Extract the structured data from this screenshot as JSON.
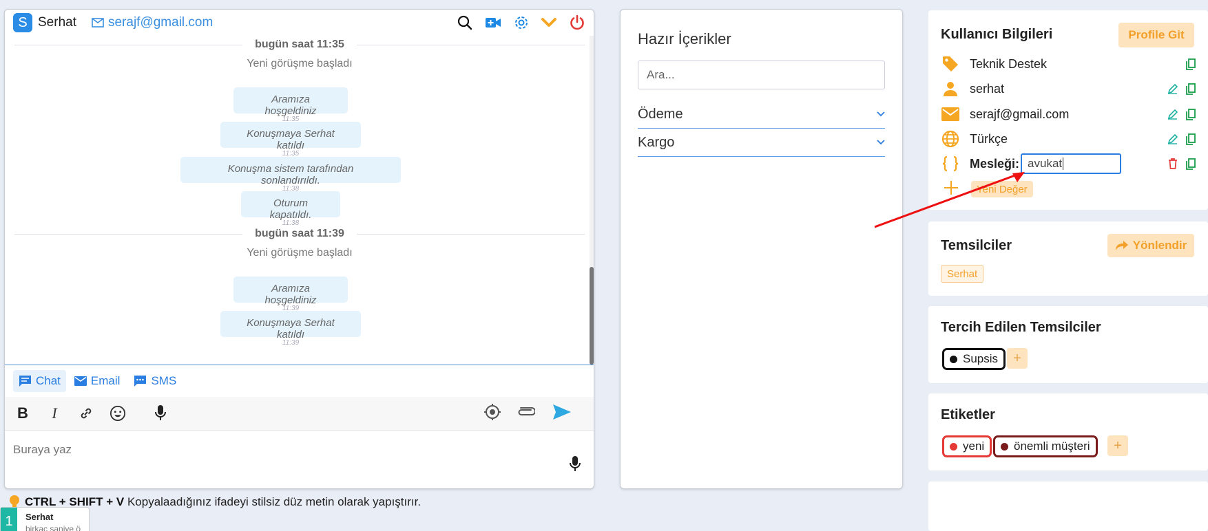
{
  "chat": {
    "user_initial": "S",
    "user_name": "Serhat",
    "user_email": "serajf@gmail.com",
    "day_sep_1": "bugün saat 11:35",
    "sys_1": "Yeni görüşme başladı",
    "msgs_1": [
      {
        "text": "Aramıza hoşgeldiniz",
        "time": "11:35"
      },
      {
        "text": "Konuşmaya Serhat katıldı",
        "time": "11:35"
      },
      {
        "text": "Konuşma sistem tarafından sonlandırıldı.",
        "time": "11:38"
      },
      {
        "text": "Oturum kapatıldı.",
        "time": "11:38"
      }
    ],
    "day_sep_2": "bugün saat 11:39",
    "sys_2": "Yeni görüşme başladı",
    "msgs_2": [
      {
        "text": "Aramıza hoşgeldiniz",
        "time": "11:39"
      },
      {
        "text": "Konuşmaya Serhat katıldı",
        "time": "11:39"
      }
    ],
    "tabs": [
      "Chat",
      "Email",
      "SMS"
    ],
    "composer_placeholder": "Buraya yaz"
  },
  "contents": {
    "title": "Hazır İçerikler",
    "search_placeholder": "Ara...",
    "sections": [
      "Ödeme",
      "Kargo"
    ]
  },
  "user_info": {
    "title": "Kullanıcı Bilgileri",
    "profile_button": "Profile Git",
    "department": "Teknik Destek",
    "name": "serhat",
    "email": "serajf@gmail.com",
    "language": "Türkçe",
    "custom_label": "Mesleği:",
    "custom_value": "avukat",
    "new_value_label": "Yeni Değer"
  },
  "agents": {
    "title": "Temsilciler",
    "redirect_button": "Yönlendir",
    "items": [
      "Serhat"
    ]
  },
  "preferred_agents": {
    "title": "Tercih Edilen Temsilciler",
    "items": [
      "Supsis"
    ]
  },
  "tags": {
    "title": "Etiketler",
    "items": [
      {
        "label": "yeni",
        "color": "#e53935"
      },
      {
        "label": "önemli müşteri",
        "color": "#7b1c1c"
      }
    ]
  },
  "tip": {
    "shortcut": "CTRL + SHIFT + V",
    "text": " Kopyalaadığınız ifadeyi stilsiz düz metin olarak yapıştırır."
  },
  "notification": {
    "badge": "1",
    "name": "Serhat",
    "subtitle": "birkaç saniye ö"
  },
  "colors": {
    "accent_blue": "#2a7de1",
    "orange": "#f2a02a",
    "orange_bg": "#fde4bf",
    "bubble_bg": "#e4f3fc",
    "annotation_red": "#ee1111"
  }
}
